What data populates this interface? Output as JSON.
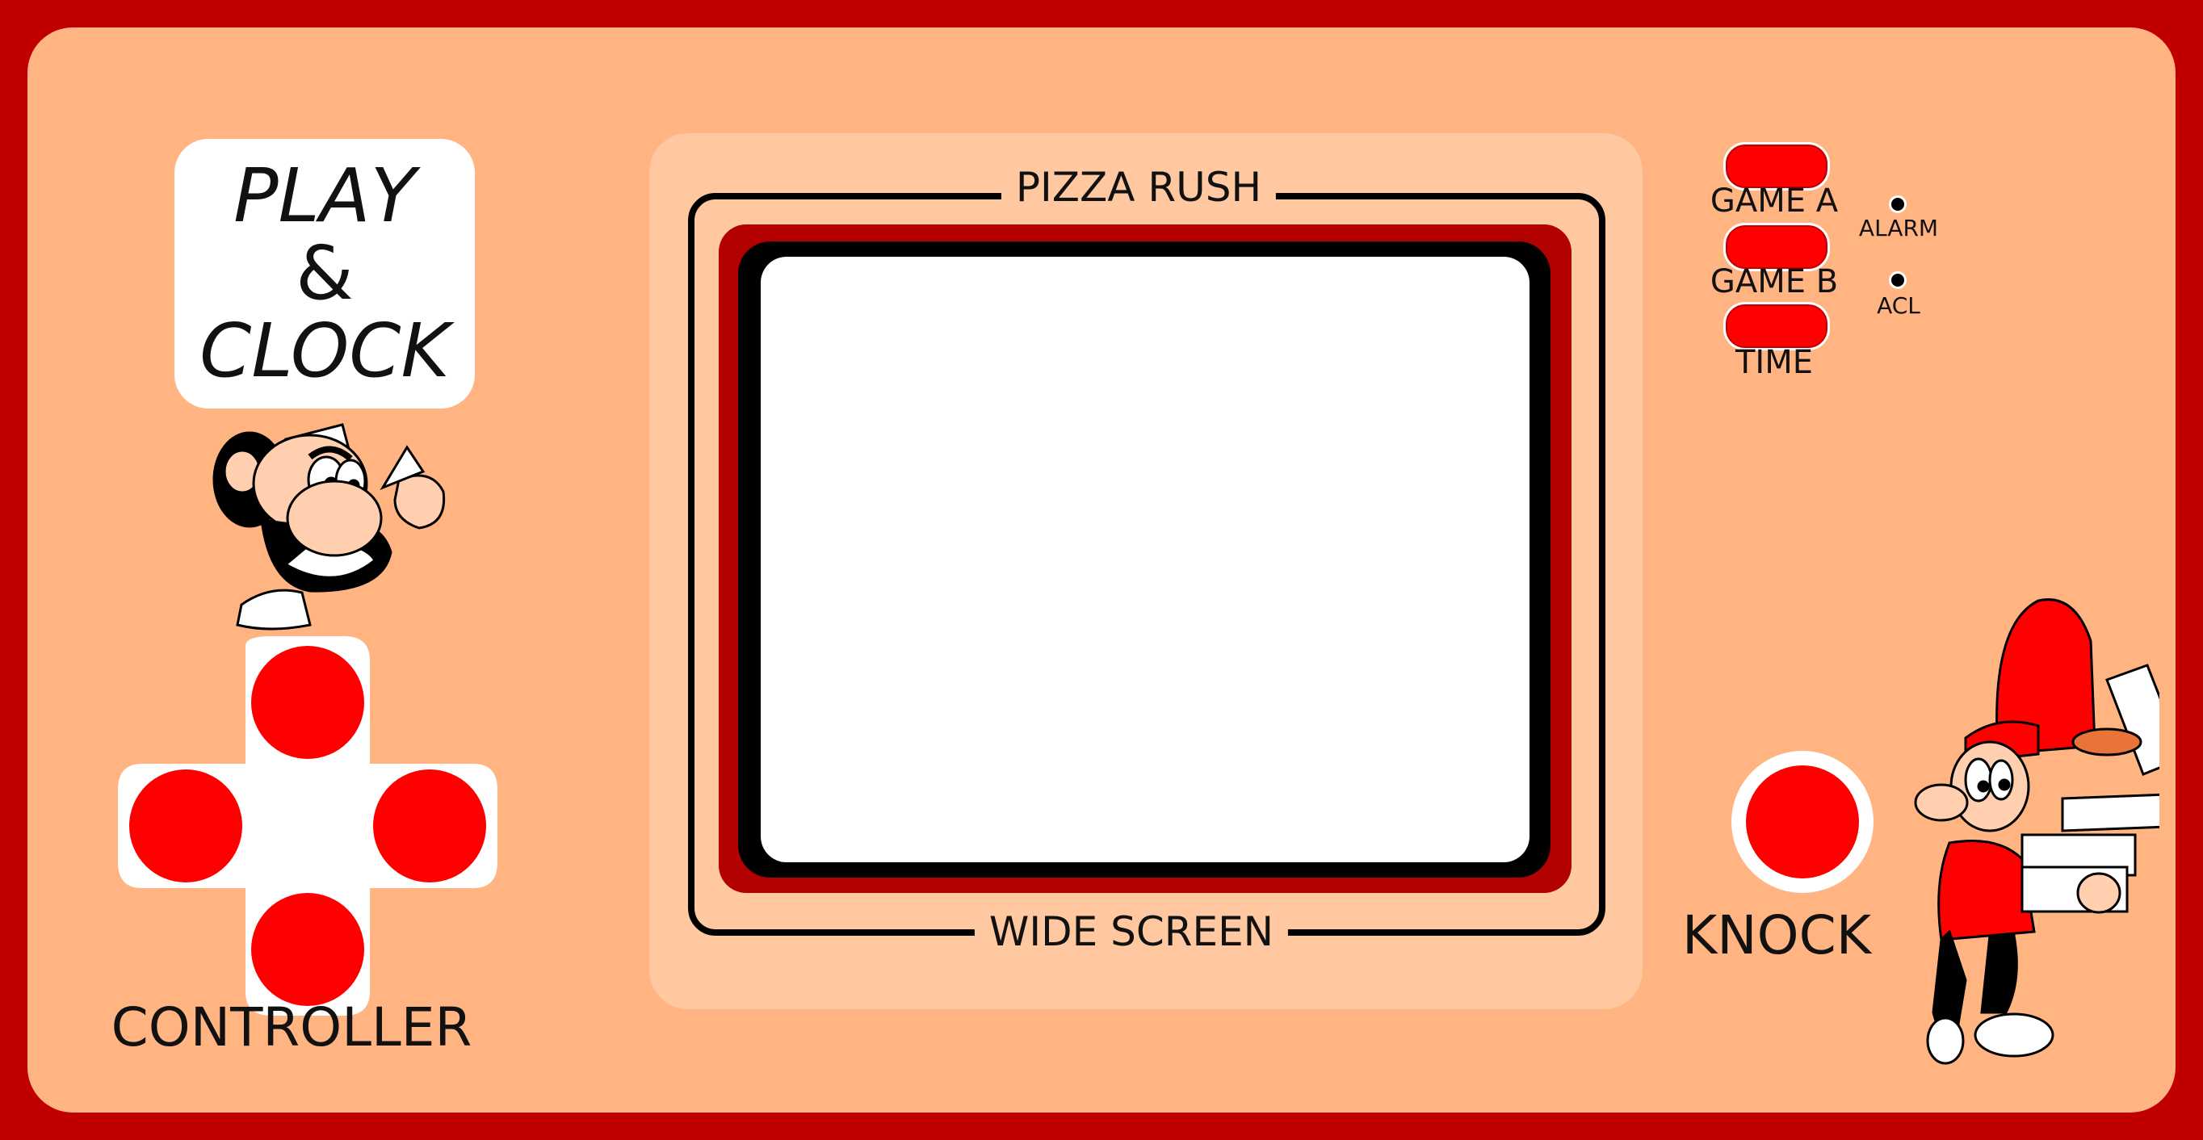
{
  "logo": {
    "line1": "PLAY",
    "line2": "&",
    "line3": "CLOCK"
  },
  "screen": {
    "top_label": "PIZZA RUSH",
    "bottom_label": "WIDE SCREEN"
  },
  "mode_buttons": [
    {
      "label": "GAME A"
    },
    {
      "label": "GAME B"
    },
    {
      "label": "TIME"
    }
  ],
  "setting_buttons": [
    {
      "label": "ALARM"
    },
    {
      "label": "ACL"
    }
  ],
  "controller": {
    "label": "CONTROLLER"
  },
  "action_button": {
    "label": "KNOCK"
  },
  "colors": {
    "case_border": "#c00000",
    "case_body": "#ffb482",
    "screen_panel": "#ffc8a0",
    "button_red": "#ff0000",
    "bezel_red": "#b30000"
  },
  "icons": [
    "chef-character-icon",
    "pizza-delivery-character-icon"
  ]
}
